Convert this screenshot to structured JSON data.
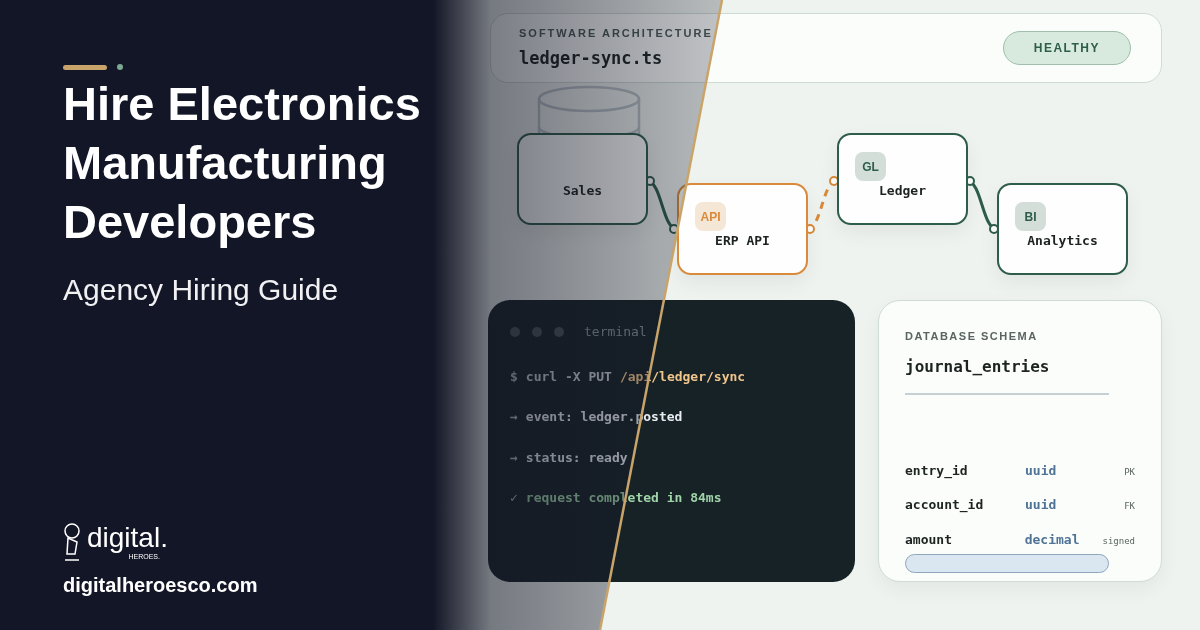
{
  "hero": {
    "title_lines": [
      "Hire Electronics",
      "Manufacturing",
      "Developers"
    ],
    "subtitle": "Agency Hiring Guide"
  },
  "brand": {
    "logo_text": "digital.",
    "logo_subtext": "HEROES.",
    "url": "digitalheroesco.com"
  },
  "header": {
    "eyebrow": "SOFTWARE ARCHITECTURE",
    "file": "ledger-sync.ts",
    "status": "HEALTHY"
  },
  "nodes": [
    {
      "label": "Sales",
      "kind": "normal"
    },
    {
      "label": "ERP API",
      "badge": "API",
      "kind": "accent"
    },
    {
      "label": "Ledger",
      "badge": "GL",
      "kind": "normal"
    },
    {
      "label": "Analytics",
      "badge": "BI",
      "kind": "normal"
    }
  ],
  "edges": [
    {
      "kind": "solid"
    },
    {
      "kind": "dashed"
    },
    {
      "kind": "solid"
    }
  ],
  "terminal": {
    "title": "terminal",
    "lines": [
      {
        "kind": "command",
        "prompt": "$",
        "text": "curl -X PUT",
        "arg": "/api/ledger/sync"
      },
      {
        "kind": "output",
        "prompt": "→",
        "text": "event: ledger.posted"
      },
      {
        "kind": "output",
        "prompt": "→",
        "text": "status: ready"
      },
      {
        "kind": "success",
        "prompt": "✓",
        "text": "request completed in 84ms"
      }
    ]
  },
  "schema": {
    "eyebrow": "DATABASE SCHEMA",
    "table": "journal_entries",
    "columns": [
      {
        "name": "entry_id",
        "type": "uuid",
        "tag": "PK"
      },
      {
        "name": "account_id",
        "type": "uuid",
        "tag": "FK"
      },
      {
        "name": "amount",
        "type": "decimal",
        "tag": "signed"
      }
    ]
  }
}
